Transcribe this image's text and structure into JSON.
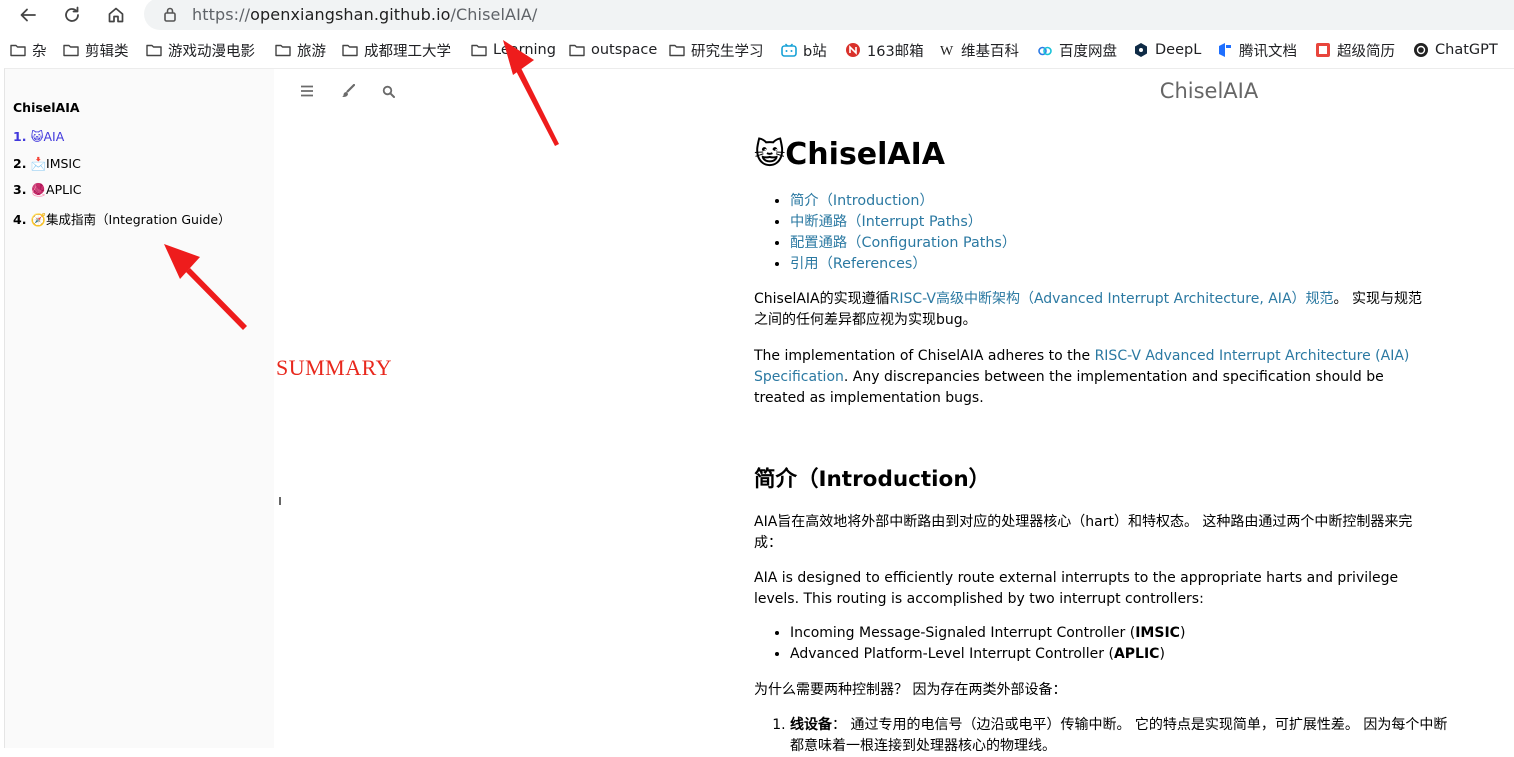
{
  "browser": {
    "url": {
      "scheme": "https://",
      "host": "openxiangshan.github.io",
      "path": "/ChiselAIA/"
    },
    "bookmarks": [
      {
        "label": "杂",
        "icon": "folder-icon"
      },
      {
        "label": "剪辑类",
        "icon": "folder-icon"
      },
      {
        "label": "游戏动漫电影",
        "icon": "folder-icon"
      },
      {
        "label": "旅游",
        "icon": "folder-icon"
      },
      {
        "label": "成都理工大学",
        "icon": "folder-icon"
      },
      {
        "label": "Learning",
        "icon": "folder-icon"
      },
      {
        "label": "outspace",
        "icon": "folder-icon"
      },
      {
        "label": "研究生学习",
        "icon": "folder-icon"
      },
      {
        "label": "b站",
        "icon": "bilibili-icon"
      },
      {
        "label": "163邮箱",
        "icon": "netease-icon"
      },
      {
        "label": "维基百科",
        "icon": "wikipedia-icon"
      },
      {
        "label": "百度网盘",
        "icon": "baidu-pan-icon"
      },
      {
        "label": "DeepL",
        "icon": "deepl-icon"
      },
      {
        "label": "腾讯文档",
        "icon": "tencent-docs-icon"
      },
      {
        "label": "超级简历",
        "icon": "resume-icon"
      },
      {
        "label": "ChatGPT",
        "icon": "chatgpt-icon"
      }
    ]
  },
  "sidebar": {
    "title": "ChiselAIA",
    "chapters": [
      {
        "num": "1.",
        "label": "😺AIA",
        "active": true
      },
      {
        "num": "2.",
        "label": "📩IMSIC",
        "active": false
      },
      {
        "num": "3.",
        "label": "🧶APLIC",
        "active": false
      },
      {
        "num": "4.",
        "label": "🧭集成指南（Integration Guide）",
        "active": false
      }
    ]
  },
  "menu_bar": {
    "title": "ChiselAIA"
  },
  "annotation": {
    "summary_label": "SUMMARY"
  },
  "content": {
    "h1_emoji": "😺",
    "h1": "ChiselAIA",
    "toc": [
      "简介（Introduction）",
      "中断通路（Interrupt Paths）",
      "配置通路（Configuration Paths）",
      "引用（References）"
    ],
    "p1_pre": "ChiselAIA的实现遵循",
    "p1_link": "RISC-V高级中断架构（Advanced Interrupt Architecture, AIA）规范",
    "p1_post": "。 实现与规范之间的任何差异都应视为实现bug。",
    "p2_pre": "The implementation of ChiselAIA adheres to the ",
    "p2_link": "RISC-V Advanced Interrupt Architecture (AIA) Specification",
    "p2_post": ". Any discrepancies between the implementation and specification should be treated as implementation bugs.",
    "h2": "简介（Introduction）",
    "p3": "AIA旨在高效地将外部中断路由到对应的处理器核心（hart）和特权态。 这种路由通过两个中断控制器来完成：",
    "p4": "AIA is designed to efficiently route external interrupts to the appropriate harts and privilege levels. This routing is accomplished by two interrupt controllers:",
    "controllers": [
      {
        "pre": "Incoming Message-Signaled Interrupt Controller (",
        "bold": "IMSIC",
        "post": ")"
      },
      {
        "pre": "Advanced Platform-Level Interrupt Controller (",
        "bold": "APLIC",
        "post": ")"
      }
    ],
    "p5": "为什么需要两种控制器？ 因为存在两类外部设备：",
    "ordered": [
      {
        "bold": "线设备",
        "text": "： 通过专用的电信号（边沿或电平）传输中断。 它的特点是实现简单，可扩展性差。 因为每个中断都意味着一根连接到处理器核心的物理线。"
      }
    ]
  }
}
